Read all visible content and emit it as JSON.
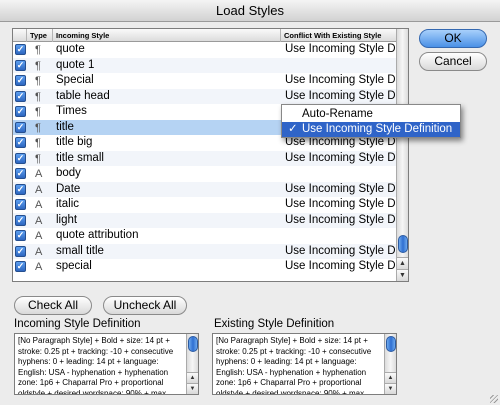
{
  "window": {
    "title": "Load Styles"
  },
  "table": {
    "headers": {
      "type": "Type",
      "incoming": "Incoming Style",
      "conflict": "Conflict With Existing Style"
    },
    "rows": [
      {
        "checked": "✓",
        "type": "¶",
        "name": "quote",
        "conflict": "Use Incoming Style D..."
      },
      {
        "checked": "✓",
        "type": "¶",
        "name": "quote 1",
        "conflict": ""
      },
      {
        "checked": "✓",
        "type": "¶",
        "name": "Special",
        "conflict": "Use Incoming Style D..."
      },
      {
        "checked": "✓",
        "type": "¶",
        "name": "table head",
        "conflict": "Use Incoming Style D..."
      },
      {
        "checked": "✓",
        "type": "¶",
        "name": "Times",
        "conflict": ""
      },
      {
        "checked": "✓",
        "type": "¶",
        "name": "title",
        "conflict": ""
      },
      {
        "checked": "✓",
        "type": "¶",
        "name": "title big",
        "conflict": "Use Incoming Style D..."
      },
      {
        "checked": "✓",
        "type": "¶",
        "name": "title small",
        "conflict": "Use Incoming Style D..."
      },
      {
        "checked": "✓",
        "type": "A",
        "name": "body",
        "conflict": ""
      },
      {
        "checked": "✓",
        "type": "A",
        "name": "Date",
        "conflict": "Use Incoming Style D..."
      },
      {
        "checked": "✓",
        "type": "A",
        "name": "italic",
        "conflict": "Use Incoming Style D..."
      },
      {
        "checked": "✓",
        "type": "A",
        "name": "light",
        "conflict": "Use Incoming Style D..."
      },
      {
        "checked": "✓",
        "type": "A",
        "name": "quote attribution",
        "conflict": ""
      },
      {
        "checked": "✓",
        "type": "A",
        "name": "small title",
        "conflict": "Use Incoming Style D..."
      },
      {
        "checked": "✓",
        "type": "A",
        "name": "special",
        "conflict": "Use Incoming Style D..."
      }
    ],
    "scroll_up_glyph": "▲",
    "scroll_down_glyph": "▼"
  },
  "popup": {
    "items": [
      {
        "label": "Auto-Rename",
        "check": ""
      },
      {
        "label": "Use Incoming Style Definition",
        "check": "✓"
      }
    ]
  },
  "buttons": {
    "ok": "OK",
    "cancel": "Cancel",
    "check_all": "Check All",
    "uncheck_all": "Uncheck All"
  },
  "incoming": {
    "label": "Incoming Style Definition",
    "text": "[No Paragraph Style] + Bold + size: 14 pt + stroke: 0.25 pt + tracking: -10 + consecutive hyphens: 0 + leading: 14 pt + language: English: USA - hyphenation + hyphenation zone: 1p6 + Chaparral Pro + proportional oldstyle + desired wordspace: 90% + max."
  },
  "existing": {
    "label": "Existing Style Definition",
    "text": "[No Paragraph Style] + Bold + size: 14 pt + stroke: 0.25 pt + tracking: -10 + consecutive hyphens: 0 + leading: 14 pt + language: English: USA - hyphenation + hyphenation zone: 1p6 + Chaparral Pro + proportional oldstyle + desired wordspace: 90% + max."
  },
  "colors": {
    "accent": "#2f64c8",
    "selection": "#b5d3f3",
    "checkbox": "#2d66c0"
  }
}
